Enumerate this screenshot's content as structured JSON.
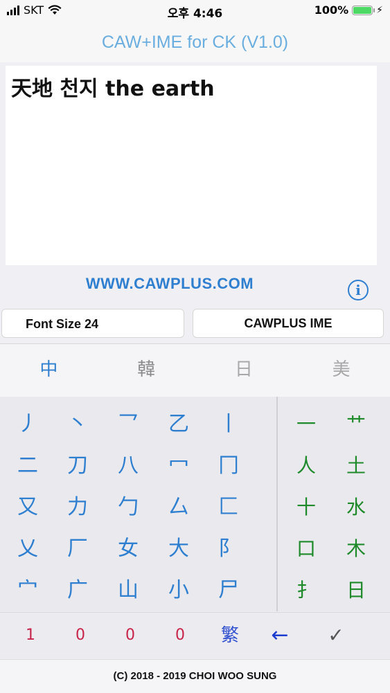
{
  "status": {
    "carrier": "SKT",
    "time": "오후 4:46",
    "battery": "100%",
    "battery_level": 1.0
  },
  "app_title": "CAW+IME for CK (V1.0)",
  "editor": {
    "text": "天地 천지 the earth"
  },
  "website": "WWW.CAWPLUS.COM",
  "info_label": "i",
  "buttons": {
    "font_size": "Font Size 24",
    "ime": "CAWPLUS IME"
  },
  "tabs": [
    "中",
    "韓",
    "日",
    "美"
  ],
  "keyboard": {
    "left_keys": [
      [
        "丿",
        "丶",
        "乛",
        "乙",
        "丨"
      ],
      [
        "二",
        "刀",
        "八",
        "冖",
        "冂"
      ],
      [
        "又",
        "力",
        "勹",
        "厶",
        "匚"
      ],
      [
        "乂",
        "厂",
        "女",
        "大",
        "阝"
      ],
      [
        "宀",
        "广",
        "山",
        "小",
        "尸"
      ]
    ],
    "right_keys": [
      [
        "一",
        "艹"
      ],
      [
        "人",
        "土"
      ],
      [
        "十",
        "水"
      ],
      [
        "口",
        "木"
      ],
      [
        "扌",
        "日"
      ]
    ]
  },
  "bottom_row": {
    "digits": [
      "1",
      "0",
      "0",
      "0"
    ],
    "traditional": "繁",
    "backspace": "←",
    "confirm": "✓"
  },
  "footer": "(C) 2018 - 2019  CHOI WOO SUNG",
  "colors": {
    "accent_blue": "#2f7fd0",
    "title_blue": "#6aaee0",
    "radical_green": "#1e8a2a",
    "digit_red": "#c8234a"
  }
}
